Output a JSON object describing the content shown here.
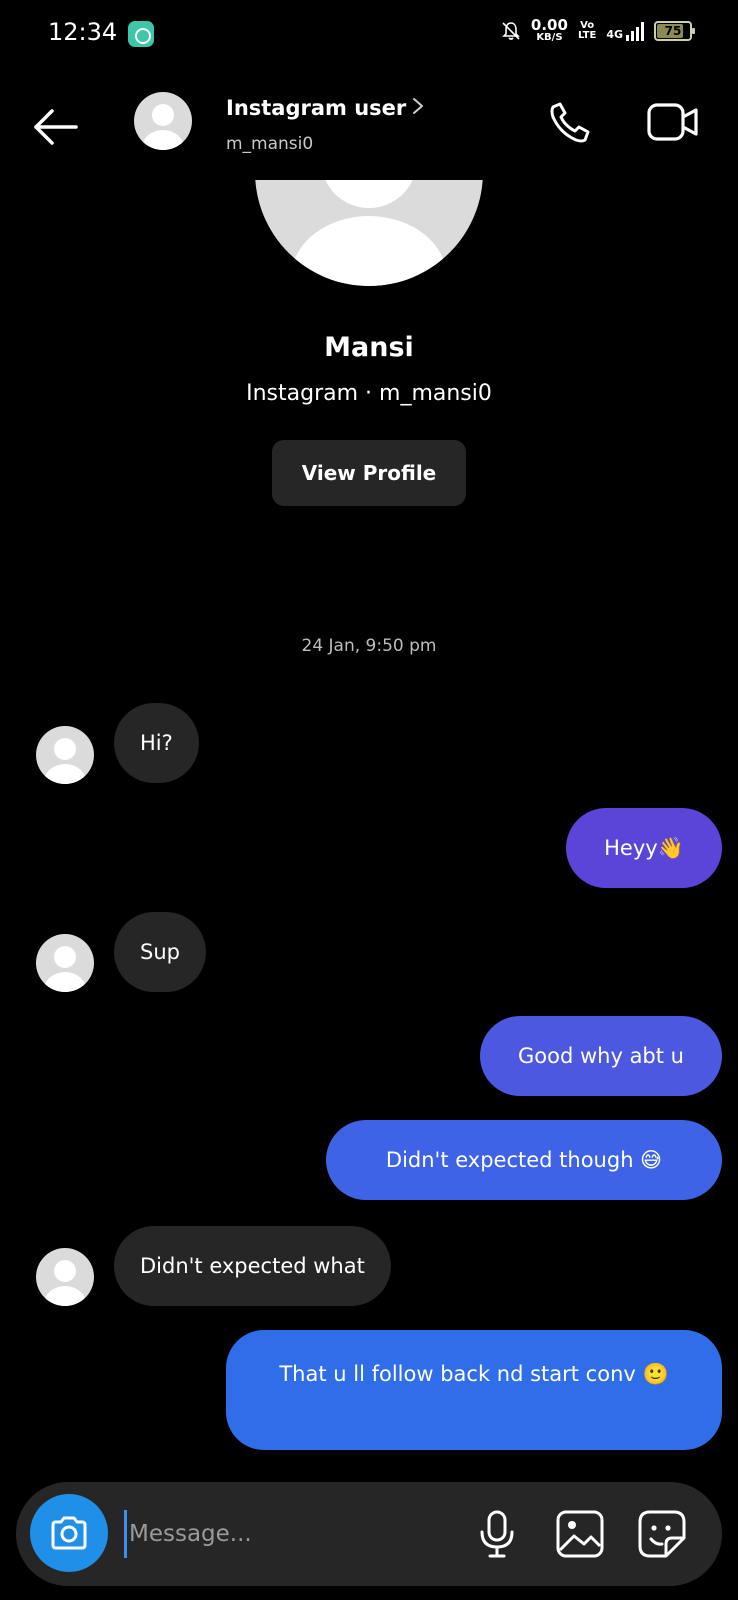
{
  "status_bar": {
    "time": "12:34",
    "net_speed_value": "0.00",
    "net_speed_unit": "KB/S",
    "volte_top": "Vo",
    "volte_bottom": "LTE",
    "network": "4G",
    "battery": "75"
  },
  "header": {
    "name": "Instagram user",
    "username": "m_mansi0"
  },
  "profile": {
    "name": "Mansi",
    "subtitle": "Instagram · m_mansi0",
    "view_profile_label": "View Profile"
  },
  "conversation": {
    "timestamp": "24 Jan, 9:50 pm",
    "messages": [
      {
        "text": "Hi?"
      },
      {
        "text": "Heyy👋"
      },
      {
        "text": "Sup"
      },
      {
        "text": "Good why abt u"
      },
      {
        "text": "Didn't expected though 😅"
      },
      {
        "text": "Didn't expected what"
      },
      {
        "text": "That u ll follow back  nd start conv 🙂"
      }
    ]
  },
  "composer": {
    "placeholder": "Message..."
  },
  "colors": {
    "accent_blue": "#1f8fe8",
    "bubble_incoming": "#262626",
    "bubble_out_1": "#5b44d8",
    "bubble_out_2": "#4d58e0",
    "bubble_out_3": "#3e63e6",
    "bubble_out_4": "#2f6ee8"
  }
}
